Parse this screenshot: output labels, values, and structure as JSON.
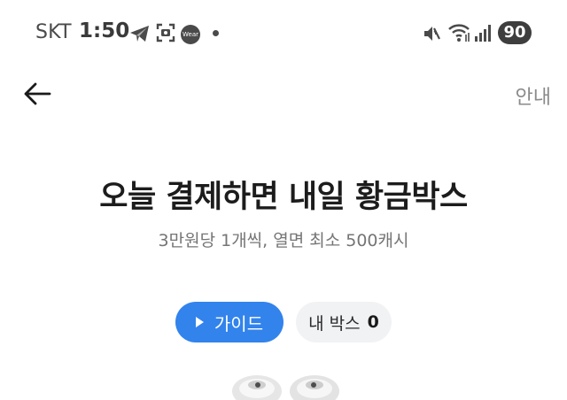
{
  "status_bar": {
    "carrier": "SKT",
    "time": "1:50",
    "wear_label": "Wear",
    "battery": "90",
    "icons": [
      "telegram-icon",
      "screenshot-icon",
      "wear-icon",
      "notification-dot-icon",
      "mute-icon",
      "wifi-icon",
      "signal-icon"
    ]
  },
  "header": {
    "back_icon": "arrow-left-icon",
    "guide_link": "안내"
  },
  "main": {
    "title": "오늘 결제하면 내일 황금박스",
    "subtitle": "3만원당 1개씩, 열면 최소 500캐시",
    "guide_button": {
      "label": "가이드",
      "icon": "play-icon",
      "color": "#3283ec"
    },
    "my_box": {
      "label": "내 박스",
      "count": "0"
    },
    "product_image": "earbuds-image"
  }
}
